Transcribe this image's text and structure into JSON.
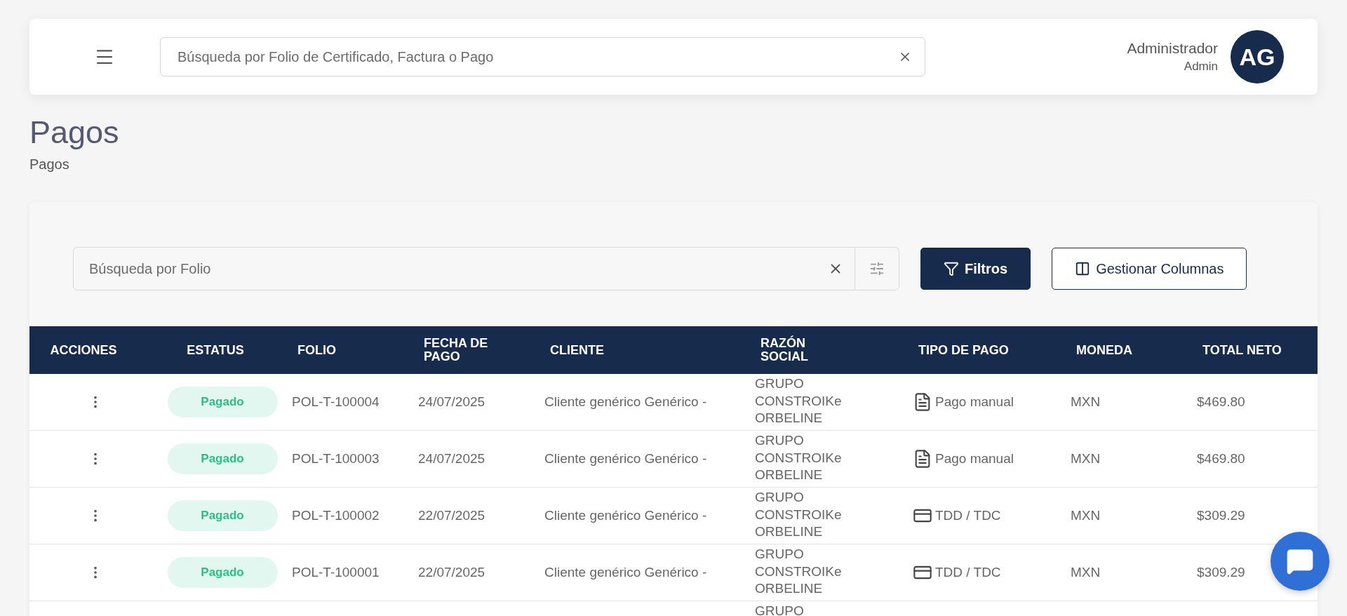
{
  "header": {
    "search": {
      "placeholder": "Búsqueda por Folio de Certificado, Factura o Pago"
    },
    "user": {
      "name": "Administrador",
      "role": "Admin",
      "initials": "AG"
    }
  },
  "page": {
    "title": "Pagos",
    "breadcrumb": "Pagos"
  },
  "toolbar": {
    "search": {
      "placeholder": "Búsqueda por Folio"
    },
    "buttons": [
      {
        "kind": "filter",
        "label": "Filtros"
      },
      {
        "kind": "columns",
        "label": "Gestionar Columnas"
      }
    ]
  },
  "table": {
    "columns": [
      "ACCIONES",
      "ESTATUS",
      "FOLIO",
      "FECHA DE PAGO",
      "CLIENTE",
      "RAZÓN SOCIAL",
      "TIPO DE PAGO",
      "MONEDA",
      "TOTAL NETO"
    ],
    "rows": [
      {
        "status": "Pagado",
        "folio": "POL-T-100004",
        "fecha": "24/07/2025",
        "cliente": "Cliente genérico Genérico -",
        "razon_social": "GRUPO CONSTROIKe ORBELINE",
        "tipo_pago": {
          "kind": "manual",
          "label": "Pago manual"
        },
        "moneda": "MXN",
        "total": "$469.80"
      },
      {
        "status": "Pagado",
        "folio": "POL-T-100003",
        "fecha": "24/07/2025",
        "cliente": "Cliente genérico Genérico -",
        "razon_social": "GRUPO CONSTROIKe ORBELINE",
        "tipo_pago": {
          "kind": "manual",
          "label": "Pago manual"
        },
        "moneda": "MXN",
        "total": "$469.80"
      },
      {
        "status": "Pagado",
        "folio": "POL-T-100002",
        "fecha": "22/07/2025",
        "cliente": "Cliente genérico Genérico -",
        "razon_social": "GRUPO CONSTROIKe ORBELINE",
        "tipo_pago": {
          "kind": "card",
          "label": "TDD / TDC"
        },
        "moneda": "MXN",
        "total": "$309.29"
      },
      {
        "status": "Pagado",
        "folio": "POL-T-100001",
        "fecha": "22/07/2025",
        "cliente": "Cliente genérico Genérico -",
        "razon_social": "GRUPO CONSTROIKe ORBELINE",
        "tipo_pago": {
          "kind": "card",
          "label": "TDD / TDC"
        },
        "moneda": "MXN",
        "total": "$309.29"
      },
      {
        "razon_social": "GRUPO"
      }
    ]
  }
}
